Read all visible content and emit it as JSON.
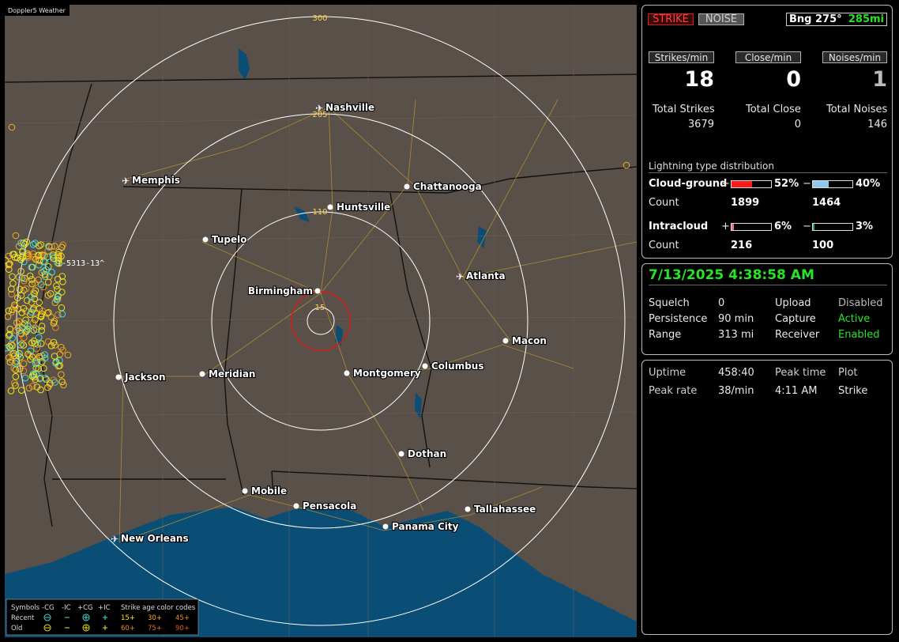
{
  "app": {
    "title": "Doppler5 Weather"
  },
  "map": {
    "range_labels": [
      "300",
      "205",
      "110",
      "15"
    ],
    "route_label": "I-5313-13^",
    "cities": [
      {
        "name": "Nashville",
        "kind": "airport"
      },
      {
        "name": "Memphis",
        "kind": "airport"
      },
      {
        "name": "Chattanooga",
        "kind": "city"
      },
      {
        "name": "Huntsville",
        "kind": "city"
      },
      {
        "name": "Tupelo",
        "kind": "city"
      },
      {
        "name": "Atlanta",
        "kind": "airport"
      },
      {
        "name": "Birmingham",
        "kind": "city"
      },
      {
        "name": "Macon",
        "kind": "city"
      },
      {
        "name": "Jackson",
        "kind": "city"
      },
      {
        "name": "Meridian",
        "kind": "city"
      },
      {
        "name": "Montgomery",
        "kind": "city"
      },
      {
        "name": "Columbus",
        "kind": "city"
      },
      {
        "name": "Dothan",
        "kind": "city"
      },
      {
        "name": "Mobile",
        "kind": "city"
      },
      {
        "name": "Pensacola",
        "kind": "city"
      },
      {
        "name": "Tallahassee",
        "kind": "city"
      },
      {
        "name": "Panama City",
        "kind": "city"
      },
      {
        "name": "New Orleans",
        "kind": "airport"
      }
    ],
    "legend": {
      "symbols_label": "Symbols",
      "headers": [
        "-CG",
        "-IC",
        "+CG",
        "+IC"
      ],
      "age_title": "Strike age color codes",
      "recent_label": "Recent",
      "old_label": "Old",
      "recent_ages": [
        "15+",
        "30+",
        "45+"
      ],
      "old_ages": [
        "60+",
        "75+",
        "90+"
      ]
    }
  },
  "status": {
    "strike_button": "STRIKE",
    "noise_button": "NOISE",
    "bearing": "Bng 275°",
    "distance": "285mi",
    "strikes_per_min_label": "Strikes/min",
    "close_per_min_label": "Close/min",
    "noises_per_min_label": "Noises/min",
    "strikes_per_min": "18",
    "close_per_min": "0",
    "noises_per_min": "1",
    "total_strikes_label": "Total Strikes",
    "total_close_label": "Total Close",
    "total_noises_label": "Total Noises",
    "total_strikes": "3679",
    "total_close": "0",
    "total_noises": "146"
  },
  "distribution": {
    "title": "Lightning type distribution",
    "cg_label": "Cloud-ground",
    "ic_label": "Intracloud",
    "count_label": "Count",
    "plus": "+",
    "minus": "−",
    "cg_pos_pct": "52%",
    "cg_neg_pct": "40%",
    "cg_pos_count": "1899",
    "cg_neg_count": "1464",
    "ic_pos_pct": "6%",
    "ic_neg_pct": "3%",
    "ic_pos_count": "216",
    "ic_neg_count": "100",
    "cg_pos_frac": 0.52,
    "cg_neg_frac": 0.4,
    "ic_pos_frac": 0.06,
    "ic_neg_frac": 0.03,
    "colors": {
      "cg_pos": "#ff1a1a",
      "cg_neg": "#8ec8f0",
      "ic_pos": "#ee6fa6",
      "ic_neg": "#1fae6a"
    }
  },
  "settings": {
    "datetime": "7/13/2025 4:38:58 AM",
    "squelch_label": "Squelch",
    "squelch": "0",
    "persistence_label": "Persistence",
    "persistence": "90 min",
    "range_label": "Range",
    "range": "313 mi",
    "upload_label": "Upload",
    "upload": "Disabled",
    "capture_label": "Capture",
    "capture": "Active",
    "receiver_label": "Receiver",
    "receiver": "Enabled"
  },
  "stats": {
    "uptime_label": "Uptime",
    "uptime": "458:40",
    "peak_rate_label": "Peak rate",
    "peak_rate": "38/min",
    "peak_time_label": "Peak time",
    "peak_time": "4:11 AM",
    "plot_label": "Plot",
    "plot": "Strike"
  }
}
